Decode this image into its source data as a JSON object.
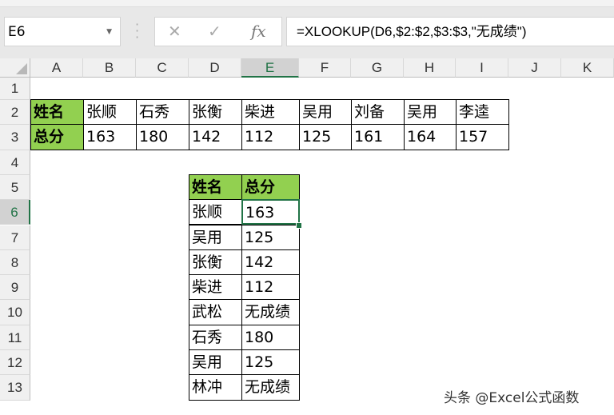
{
  "name_box": "E6",
  "formula": "=XLOOKUP(D6,$2:$2,$3:$3,\"无成绩\")",
  "icons": {
    "cancel": "✕",
    "enter": "✓",
    "fx": "fx"
  },
  "columns": [
    "A",
    "B",
    "C",
    "D",
    "E",
    "F",
    "G",
    "H",
    "I",
    "J",
    "K"
  ],
  "rows": [
    "1",
    "2",
    "3",
    "4",
    "5",
    "6",
    "7",
    "8",
    "9",
    "10",
    "11",
    "12",
    "13"
  ],
  "top_table": {
    "row_label_name": "姓名",
    "row_label_score": "总分",
    "names": [
      "张顺",
      "石秀",
      "张衡",
      "柴进",
      "吴用",
      "刘备",
      "吴用",
      "李逵"
    ],
    "scores": [
      "163",
      "180",
      "142",
      "112",
      "125",
      "161",
      "164",
      "157"
    ]
  },
  "lookup_table": {
    "headers": [
      "姓名",
      "总分"
    ],
    "rows": [
      [
        "张顺",
        "163"
      ],
      [
        "吴用",
        "125"
      ],
      [
        "张衡",
        "142"
      ],
      [
        "柴进",
        "112"
      ],
      [
        "武松",
        "无成绩"
      ],
      [
        "石秀",
        "180"
      ],
      [
        "吴用",
        "125"
      ],
      [
        "林冲",
        "无成绩"
      ]
    ]
  },
  "watermark": "头条 @Excel公式函数",
  "colors": {
    "header_green": "#92d050",
    "selection": "#217346"
  }
}
